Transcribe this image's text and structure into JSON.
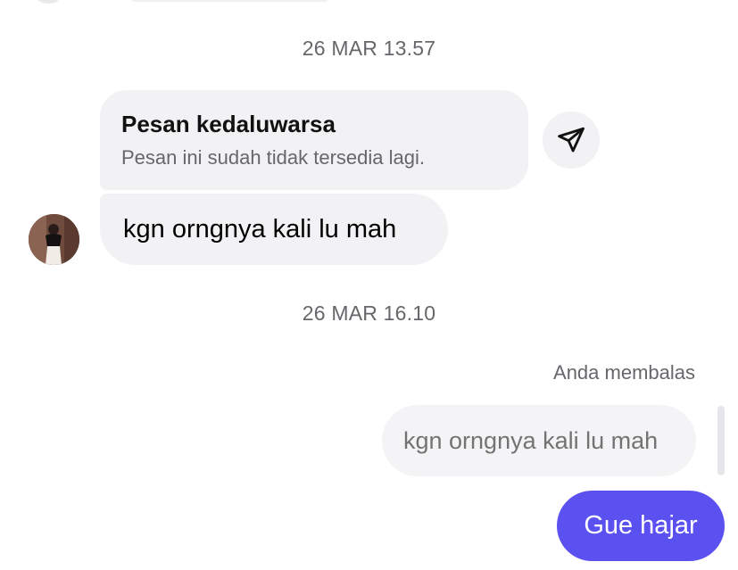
{
  "thread": {
    "timestamp_1": "26 MAR 13.57",
    "timestamp_2": "26 MAR 16.10"
  },
  "expired_message": {
    "title": "Pesan kedaluwarsa",
    "subtitle": "Pesan ini sudah tidak tersedia lagi.",
    "action_icon": "forward-icon"
  },
  "incoming_message": {
    "text": "kgn orngnya kali lu mah",
    "avatar_icon": "user-avatar"
  },
  "reply": {
    "label": "Anda membalas",
    "quoted_text": "kgn orngnya kali lu mah"
  },
  "outgoing_message": {
    "text": "Gue hajar"
  },
  "colors": {
    "outgoing_bubble": "#5b50f0",
    "incoming_bubble": "#f2f2f5",
    "muted_text": "#65676b"
  }
}
